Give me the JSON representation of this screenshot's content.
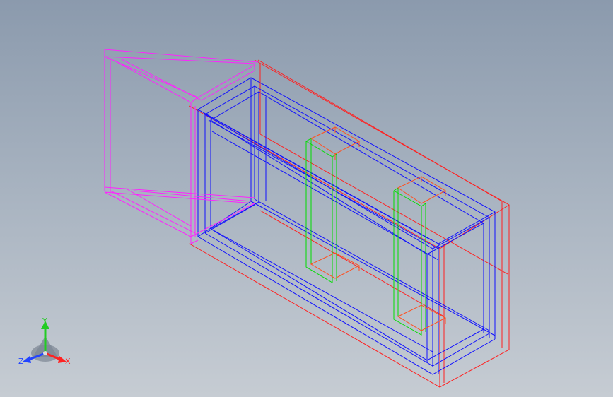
{
  "viewport": {
    "background_top": "#8b9aad",
    "background_bottom": "#c6ccd3"
  },
  "model": {
    "colors": {
      "outer_shell": "#ff2020",
      "inner_frame": "#1010ff",
      "hopper": "#ff22ff",
      "supports_green": "#00dd00",
      "support_caps": "#ff5020"
    }
  },
  "triad": {
    "y_label": "Y",
    "x_label": "X",
    "z_label": "Z",
    "y_color": "#22cc22",
    "x_color": "#ff2222",
    "z_color": "#2244ff"
  }
}
